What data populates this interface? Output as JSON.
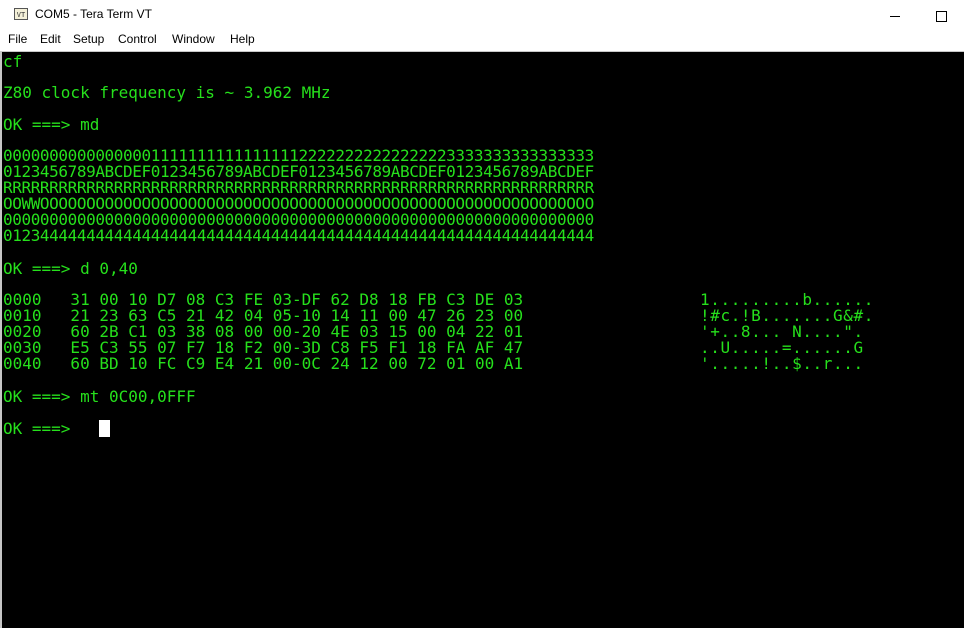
{
  "window": {
    "title": "COM5 - Tera Term VT",
    "icon": "tera-term-icon",
    "icon_text": "VT"
  },
  "menu": [
    "File",
    "Edit",
    "Setup",
    "Control",
    "Window",
    "Help"
  ],
  "terminal": {
    "colors": {
      "foreground": "#26e01c",
      "background": "#000000",
      "cursor": "#ffffff"
    },
    "line_cf": "cf",
    "line_freq": "Z80 clock frequency is ~ 3.962 MHz",
    "line_md": "OK ===> md",
    "memory_map": [
      "0000000000000000111111111111111122222222222222223333333333333333",
      "0123456789ABCDEF0123456789ABCDEF0123456789ABCDEF0123456789ABCDEF",
      "RRRRRRRRRRRRRRRRRRRRRRRRRRRRRRRRRRRRRRRRRRRRRRRRRRRRRRRRRRRRRRRR",
      "OOWWOOOOOOOOOOOOOOOOOOOOOOOOOOOOOOOOOOOOOOOOOOOOOOOOOOOOOOOOOOOO",
      "0000000000000000000000000000000000000000000000000000000000000000",
      "0123444444444444444444444444444444444444444444444444444444444444"
    ],
    "line_d": "OK ===> d 0,40",
    "hex_dump": [
      {
        "hex": "0000   31 00 10 D7 08 C3 FE 03-DF 62 D8 18 FB C3 DE 03",
        "ascii": "1.........b......"
      },
      {
        "hex": "0010   21 23 63 C5 21 42 04 05-10 14 11 00 47 26 23 00",
        "ascii": "!#c.!B.......G&#."
      },
      {
        "hex": "0020   60 2B C1 03 38 08 00 00-20 4E 03 15 00 04 22 01",
        "ascii": "'+..8... N....\"."
      },
      {
        "hex": "0030   E5 C3 55 07 F7 18 F2 00-3D C8 F5 F1 18 FA AF 47",
        "ascii": "..U.....=......G"
      },
      {
        "hex": "0040   60 BD 10 FC C9 E4 21 00-0C 24 12 00 72 01 00 A1",
        "ascii": "'.....!..$..r..."
      }
    ],
    "line_mt": "OK ===> mt 0C00,0FFF",
    "prompt": "OK ===>"
  }
}
